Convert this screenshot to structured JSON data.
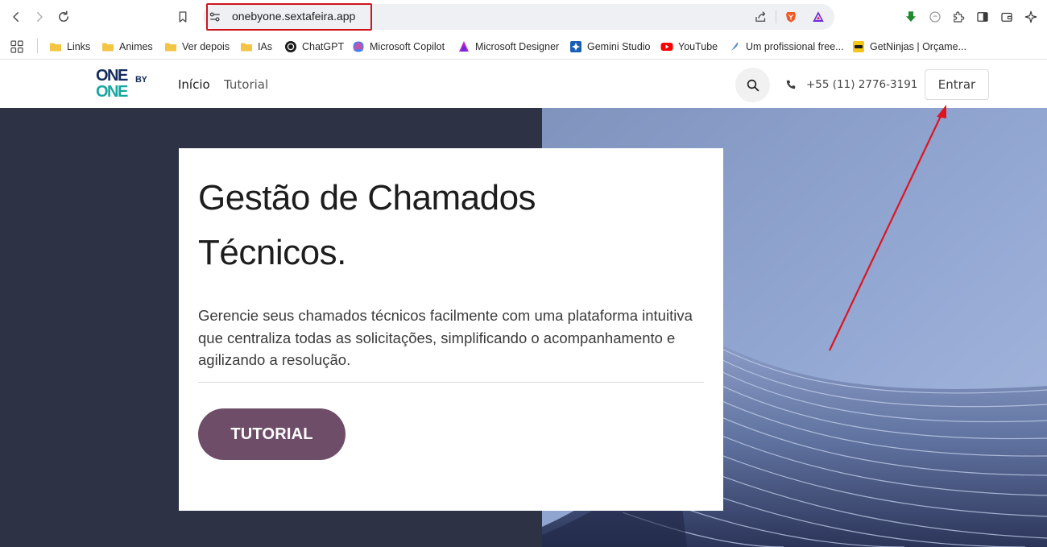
{
  "browser": {
    "url": "onebyone.sextafeira.app",
    "bookmarks": [
      {
        "label": "Links",
        "icon": "folder-icon"
      },
      {
        "label": "Animes",
        "icon": "folder-icon"
      },
      {
        "label": "Ver depois",
        "icon": "folder-icon"
      },
      {
        "label": "IAs",
        "icon": "folder-icon"
      },
      {
        "label": "ChatGPT",
        "icon": "chatgpt-icon"
      },
      {
        "label": "Microsoft Copilot",
        "icon": "copilot-icon"
      },
      {
        "label": "Microsoft Designer",
        "icon": "designer-icon"
      },
      {
        "label": "Gemini Studio",
        "icon": "gemini-icon"
      },
      {
        "label": "YouTube",
        "icon": "youtube-icon"
      },
      {
        "label": "Um profissional free...",
        "icon": "feather-icon"
      },
      {
        "label": "GetNinjas | Orçame...",
        "icon": "getninjas-icon"
      }
    ]
  },
  "site": {
    "logo_top": "ONE",
    "logo_by": "BY",
    "logo_bottom": "ONE",
    "nav": [
      "Início",
      "Tutorial"
    ],
    "phone": "+55 (11) 2776-3191",
    "login_label": "Entrar"
  },
  "hero": {
    "title_line1": "Gestão de Chamados",
    "title_line2": "Técnicos.",
    "description": "Gerencie seus chamados técnicos facilmente com uma plataforma intuitiva que centraliza todas as solicitações, simplificando o acompanhamento e agilizando a resolução.",
    "cta_label": "TUTORIAL"
  },
  "colors": {
    "hero_dark": "#2d3245",
    "cta": "#6e4d68",
    "logo_navy": "#152d5c",
    "logo_teal": "#1aa6a0",
    "annotation_red": "#e0141e"
  }
}
